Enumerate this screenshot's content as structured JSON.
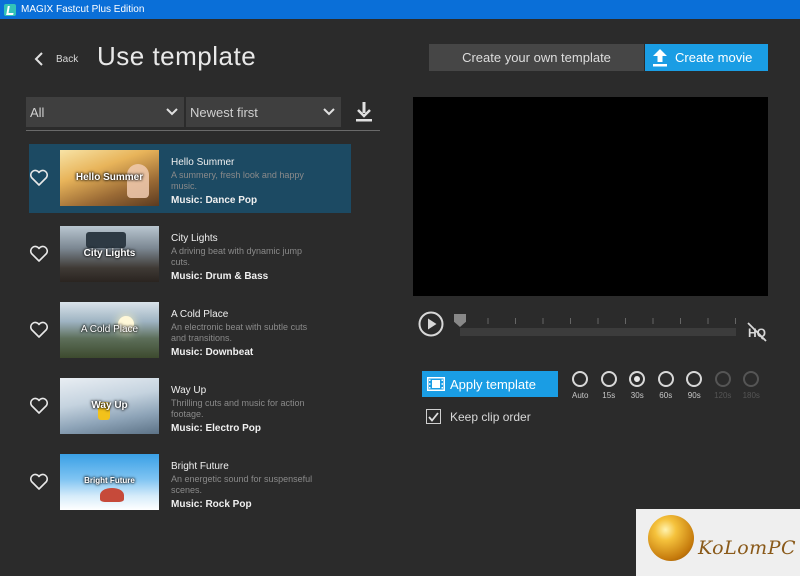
{
  "window": {
    "title": "MAGIX Fastcut Plus Edition"
  },
  "header": {
    "back_label": "Back",
    "page_title": "Use template",
    "own_template_label": "Create your own template",
    "create_movie_label": "Create movie"
  },
  "filters": {
    "category": "All",
    "sort": "Newest first"
  },
  "templates": [
    {
      "name": "Hello Summer",
      "desc": "A summery, fresh look and happy music.",
      "music": "Music: Dance Pop",
      "caption": "Hello Summer",
      "selected": true
    },
    {
      "name": "City Lights",
      "desc": "A driving beat with dynamic jump cuts.",
      "music": "Music: Drum & Bass",
      "caption": "City Lights"
    },
    {
      "name": "A Cold Place",
      "desc": "An electronic beat with subtle cuts and transitions.",
      "music": "Music: Downbeat",
      "caption": "A Cold Place"
    },
    {
      "name": "Way Up",
      "desc": "Thrilling cuts and music for action footage.",
      "music": "Music: Electro Pop",
      "caption": "Way Up"
    },
    {
      "name": "Bright Future",
      "desc": "An energetic sound for suspenseful scenes.",
      "music": "Music: Rock Pop",
      "caption": "Bright Future"
    }
  ],
  "player": {
    "apply_label": "Apply template",
    "keep_clip_order_label": "Keep clip order",
    "keep_clip_order": true,
    "position": 0
  },
  "durations": [
    {
      "label": "Auto",
      "checked": false,
      "disabled": false
    },
    {
      "label": "15s",
      "checked": false,
      "disabled": false
    },
    {
      "label": "30s",
      "checked": true,
      "disabled": false
    },
    {
      "label": "60s",
      "checked": false,
      "disabled": false
    },
    {
      "label": "90s",
      "checked": false,
      "disabled": false
    },
    {
      "label": "120s",
      "checked": false,
      "disabled": true
    },
    {
      "label": "180s",
      "checked": false,
      "disabled": true
    }
  ],
  "watermark": {
    "text": "KoLomPC"
  },
  "colors": {
    "accent": "#1a9de4",
    "selected_row": "#1c4a63",
    "titlebar": "#0a6fd8"
  }
}
